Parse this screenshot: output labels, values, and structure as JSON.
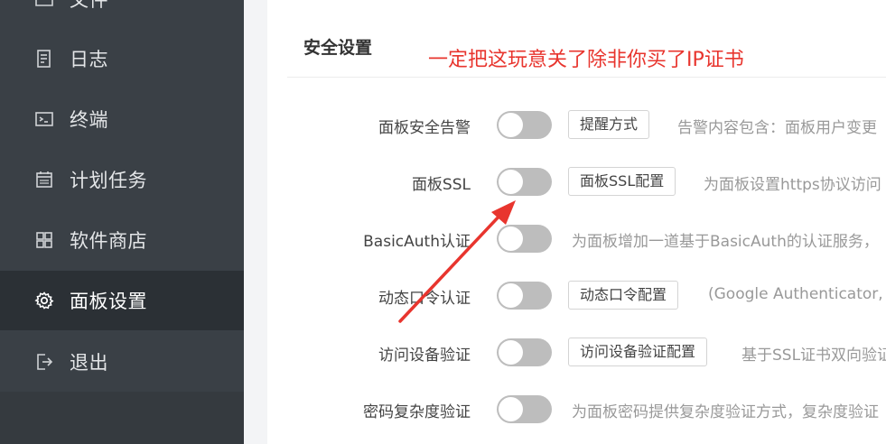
{
  "sidebar": {
    "items": [
      {
        "label": "文件",
        "icon": "folder-icon"
      },
      {
        "label": "日志",
        "icon": "log-icon"
      },
      {
        "label": "终端",
        "icon": "terminal-icon"
      },
      {
        "label": "计划任务",
        "icon": "calendar-icon"
      },
      {
        "label": "软件商店",
        "icon": "grid-icon"
      },
      {
        "label": "面板设置",
        "icon": "gear-icon",
        "active": true
      },
      {
        "label": "退出",
        "icon": "logout-icon"
      }
    ]
  },
  "main": {
    "section_title": "安全设置",
    "annotation": "一定把这玩意关了除非你买了IP证书",
    "annotation_color": "#e8352e",
    "rows": [
      {
        "label": "面板安全告警",
        "button": "提醒方式",
        "desc": "告警内容包含：面板用户变更"
      },
      {
        "label": "面板SSL",
        "button": "面板SSL配置",
        "desc": "为面板设置https协议访问"
      },
      {
        "label": "BasicAuth认证",
        "button": "",
        "desc": "为面板增加一道基于BasicAuth的认证服务，"
      },
      {
        "label": "动态口令认证",
        "button": "动态口令配置",
        "desc": "(Google Authenticator,"
      },
      {
        "label": "访问设备验证",
        "button": "访问设备验证配置",
        "desc": "基于SSL证书双向验证"
      },
      {
        "label": "密码复杂度验证",
        "button": "",
        "desc": "为面板密码提供复杂度验证方式，复杂度验证"
      }
    ]
  }
}
